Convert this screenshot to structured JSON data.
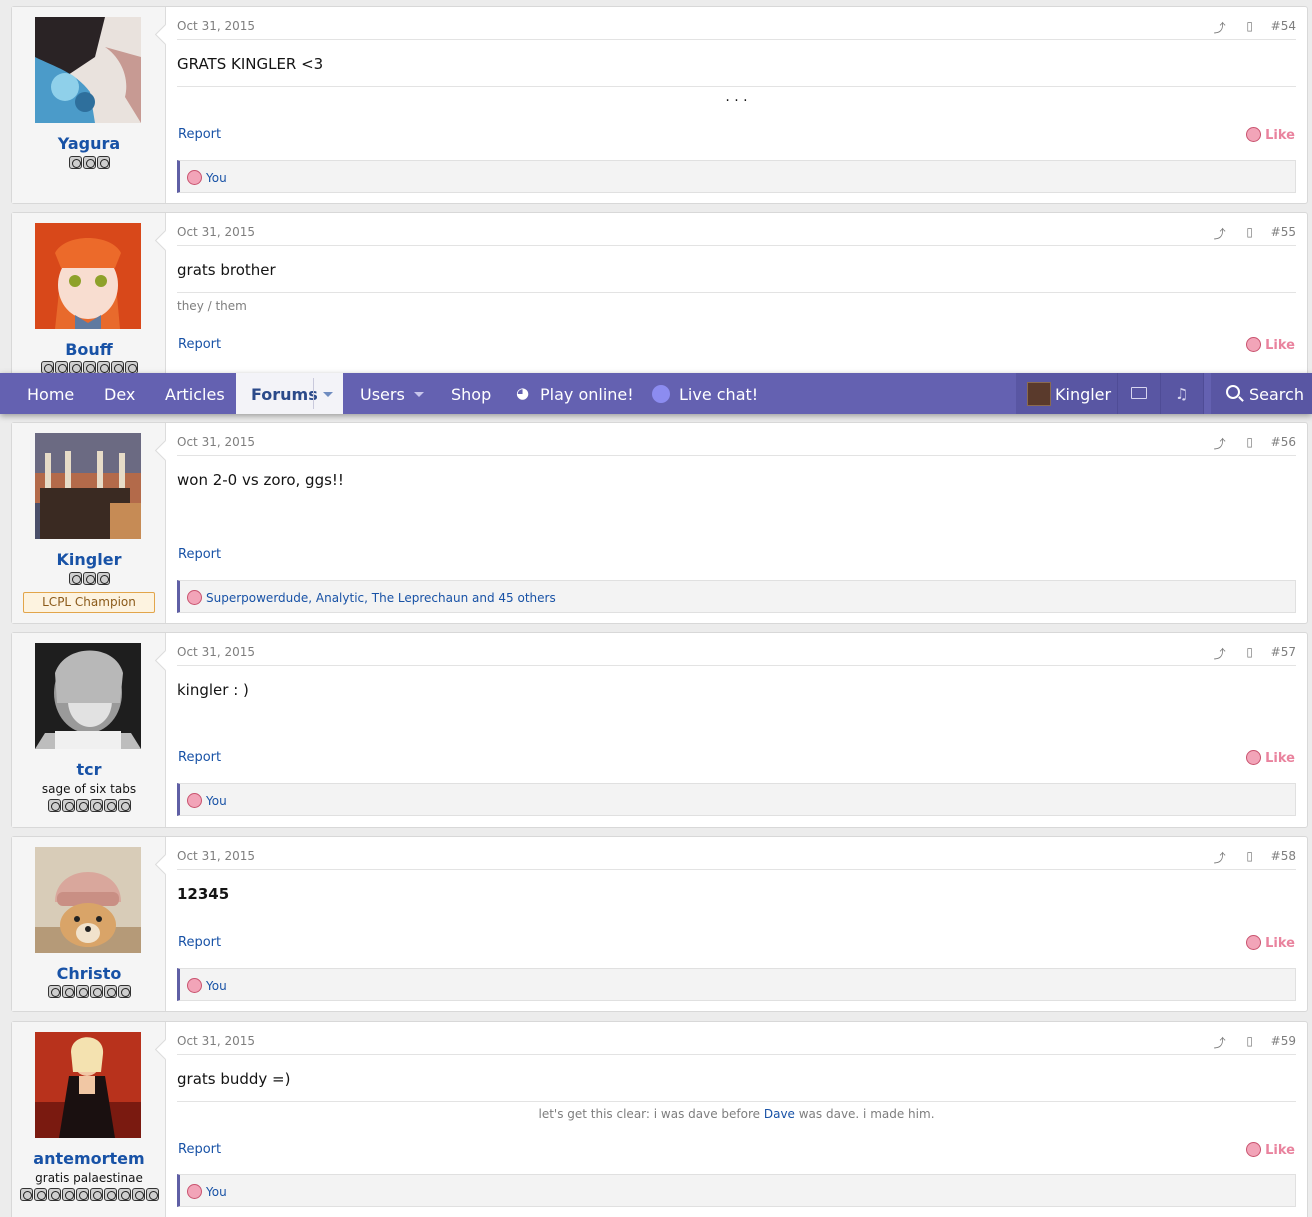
{
  "nav": {
    "home": "Home",
    "dex": "Dex",
    "articles": "Articles",
    "forums": "Forums",
    "users": "Users",
    "shop": "Shop",
    "play_online": "Play online!",
    "live_chat": "Live chat!",
    "account_name": "Kingler",
    "search": "Search"
  },
  "common": {
    "report": "Report",
    "like": "Like",
    "share_icon": "share-icon",
    "bookmark_icon": "bookmark-icon"
  },
  "posts": [
    {
      "username": "Yagura",
      "date": "Oct 31, 2015",
      "number": "#54",
      "body": "GRATS KINGLER <3",
      "signature": "· · ·",
      "reactions": "You",
      "badge_count": 3
    },
    {
      "username": "Bouff",
      "date": "Oct 31, 2015",
      "number": "#55",
      "body": "grats brother",
      "pronouns": "they / them",
      "badge_count": 7
    },
    {
      "username": "Kingler",
      "date": "Oct 31, 2015",
      "number": "#56",
      "body": "won 2-0 vs zoro, ggs!!",
      "banner": "LCPL Champion",
      "reactions": "Superpowerdude, Analytic, The Leprechaun and 45 others",
      "badge_count": 3
    },
    {
      "username": "tcr",
      "user_title": "sage of six tabs",
      "date": "Oct 31, 2015",
      "number": "#57",
      "body": "kingler : )",
      "reactions": "You",
      "badge_count": 6
    },
    {
      "username": "Christo",
      "date": "Oct 31, 2015",
      "number": "#58",
      "body": "12345",
      "reactions": "You",
      "badge_count": 6
    },
    {
      "username": "antemortem",
      "user_title": "gratis palaestinae",
      "date": "Oct 31, 2015",
      "number": "#59",
      "body": "grats buddy =)",
      "signature_before": "let's get this clear: i was dave before ",
      "signature_link": "Dave",
      "signature_after": " was dave. i made him.",
      "reactions": "You",
      "badge_count": 10
    }
  ]
}
